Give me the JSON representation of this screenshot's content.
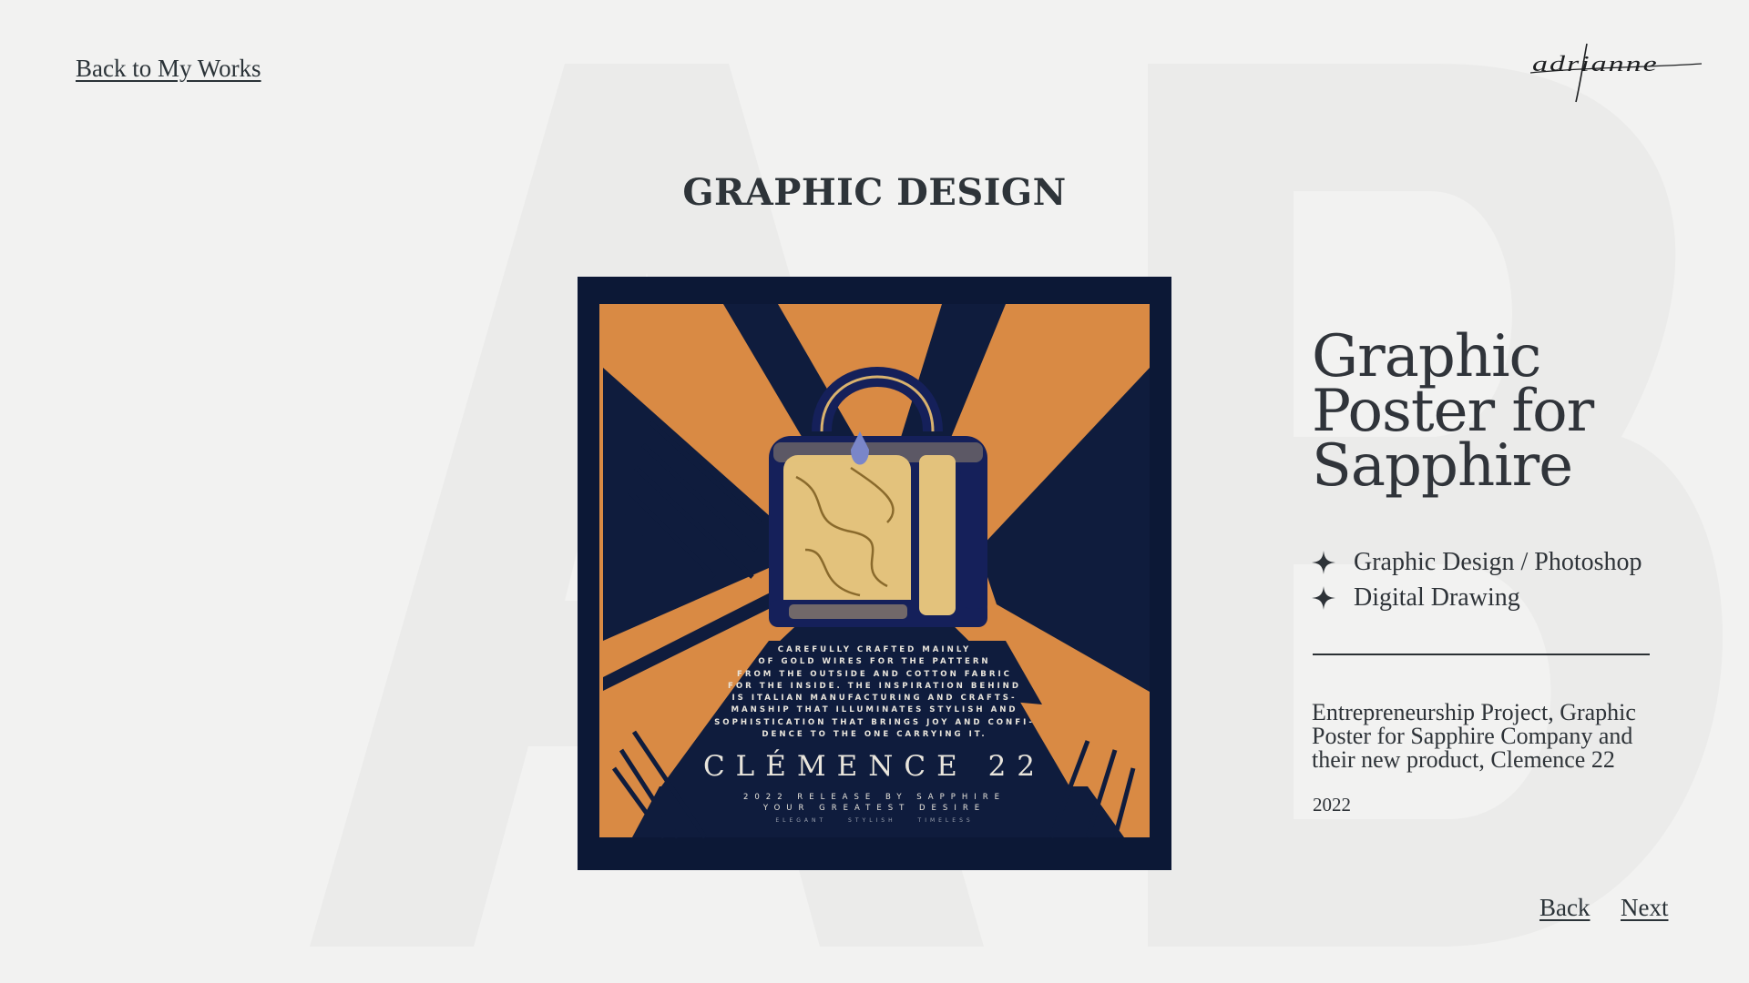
{
  "header": {
    "back_link": "Back to My Works",
    "logo_signature": "adrianne"
  },
  "section_title": "GRAPHIC DESIGN",
  "background_monogram": "AB",
  "poster": {
    "body_lines": [
      "CAREFULLY CRAFTED MAINLY",
      "OF GOLD WIRES FOR THE PATTERN",
      "FROM THE OUTSIDE AND COTTON FABRIC",
      "FOR THE INSIDE. THE INSPIRATION BEHIND",
      "IS ITALIAN MANUFACTURING AND CRAFTS-",
      "MANSHIP THAT ILLUMINATES STYLISH AND",
      "SOPHISTICATION THAT BRINGS JOY AND CONFI-",
      "DENCE TO THE ONE CARRYING IT."
    ],
    "brand": "CLÉMENCE 22",
    "release_line": "2022 RELEASE BY SAPPHIRE",
    "tagline": "YOUR GREATEST DESIRE",
    "tags": "ELEGANT STYLISH TIMELESS"
  },
  "project": {
    "title_lines": [
      "Graphic",
      "Poster for",
      "Sapphire"
    ],
    "tags": [
      {
        "icon": "sparkle-icon",
        "label": "Graphic Design / Photoshop"
      },
      {
        "icon": "sparkle-icon",
        "label": "Digital Drawing"
      }
    ],
    "description": "Entrepreneurship Project, Graphic Poster for Sapphire Company and their new product, Clemence 22",
    "year": "2022"
  },
  "nav": {
    "back": "Back",
    "next": "Next"
  },
  "colors": {
    "page_bg": "#f2f2f1",
    "text": "#2b2f33",
    "poster_navy": "#0c1836",
    "poster_orange": "#d98a44",
    "bag_gold": "#e3c27c"
  }
}
